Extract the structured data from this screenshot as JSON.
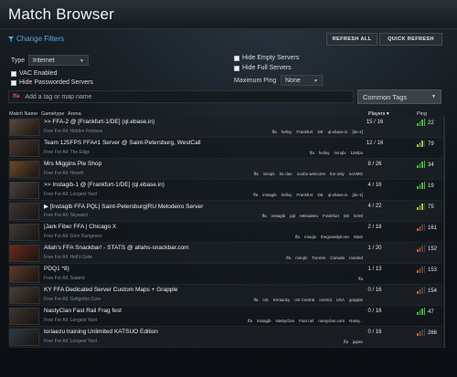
{
  "window": {
    "title": "Match Browser"
  },
  "filters": {
    "change_filters_label": "Change Filters",
    "refresh_all_label": "REFRESH ALL",
    "quick_refresh_label": "QUICK REFRESH",
    "type_label": "Type",
    "type_value": "Internet",
    "vac_enabled_label": "VAC Enabled",
    "hide_passworded_label": "Hide Passworded Servers",
    "hide_empty_label": "Hide Empty Servers",
    "hide_full_label": "Hide Full Servers",
    "max_ping_label": "Maximum Ping",
    "max_ping_value": "None",
    "tag_placeholder": "Add a tag or map name",
    "tag_icon_text": "ffa",
    "common_tags_label": "Common Tags"
  },
  "columns": {
    "match_name": "Match Name",
    "gametype": "Gametype",
    "arena": "Arena",
    "players": "Players",
    "ping": "Ping"
  },
  "colors": {
    "accent": "#5aa9e6",
    "ping_good": "#3fbf3f",
    "ping_mid": "#a8c83a",
    "ping_bad": "#e05a2a"
  },
  "servers": [
    {
      "name": ">> FFA-2 @ [Frankfurt-1/DE] (ql.ebase.in)",
      "mode": "Free For All: Hidden Fortress",
      "tags": [
        "ffa",
        "helloy",
        "Frankfurt",
        "DE",
        "ql.ebase.in",
        "[de-1]"
      ],
      "players": "15 / 16",
      "ping": "22",
      "quality": "good",
      "thumb": "#5a4a3a"
    },
    {
      "name": "Team 125FPS FFA#1 Server @ Saint-Petersburg, WestCall",
      "mode": "Free For All: The Edge",
      "tags": [
        "ffa",
        "helloy",
        "minqlx",
        "125fps"
      ],
      "players": "12 / 16",
      "ping": "79",
      "quality": "mid",
      "thumb": "#4a3a2e"
    },
    {
      "name": "Mrs Miggins Pie Shop",
      "mode": "Free For All: Hearth",
      "tags": [
        "ffa",
        "minqlx",
        "lts clan",
        "noobs welcome",
        "fun only",
        "noVMG"
      ],
      "players": "8 / 26",
      "ping": "34",
      "quality": "good",
      "thumb": "#6a4a2a"
    },
    {
      "name": ">> Instagib-1 @ [Frankfurt-1/DE] (ql.ebase.in)",
      "mode": "Free For All: Longest Yard",
      "tags": [
        "ffa",
        "instagib",
        "helloy",
        "Frankfurt",
        "DE",
        "ql.ebase.in",
        "[de-1]"
      ],
      "players": "4 / 16",
      "ping": "19",
      "quality": "good",
      "thumb": "#4a4440"
    },
    {
      "name": "▶ [Instagib FFA PQL] Saint-Petersburg|RU Melodeiro Server",
      "mode": "Free For All: Skyward",
      "tags": [
        "ffa",
        "instagib",
        "pql",
        "Melodeiro",
        "Frankfurt",
        "DE",
        "EAM"
      ],
      "players": "4 / 22",
      "ping": "75",
      "quality": "mid",
      "thumb": "#3a3634"
    },
    {
      "name": "|Jark Fiber FFA | Chicago X",
      "mode": "Free For All: Grim Dungeons",
      "tags": [
        "ffa",
        "minqlx",
        "thegravelpit.net",
        "Stats"
      ],
      "players": "2 / 18",
      "ping": "161",
      "quality": "bad",
      "thumb": "#3e3a36"
    },
    {
      "name": "Allah's FFA Snackbar! - STATS @ allahs-snackbar.com",
      "mode": "Free For All: Hell's Gate",
      "tags": [
        "ffa",
        "minqlx",
        "Toronto",
        "Canada",
        "roasted"
      ],
      "players": "1 / 20",
      "ping": "152",
      "quality": "bad",
      "thumb": "#6a2a1a"
    },
    {
      "name": "PDQ1 *8)",
      "mode": "Free For All: Satanic",
      "tags": [
        "ffa"
      ],
      "players": "1 / 13",
      "ping": "153",
      "quality": "bad",
      "thumb": "#5a3a2a"
    },
    {
      "name": "KY FFA Dedicated Server Custom Maps + Grapple",
      "mode": "Free For All: Gollgothe Core",
      "tags": [
        "ffa",
        "US",
        "Kentucky",
        "US Central",
        "central",
        "USA",
        "grapple"
      ],
      "players": "0 / 16",
      "ping": "154",
      "quality": "bad",
      "thumb": "#4a4038"
    },
    {
      "name": "NastyClan Fast Rail Frag fest",
      "mode": "Free For All: Longest Yard",
      "tags": [
        "ffa",
        "instagib",
        "NastyClan",
        "Fast rail",
        "nastyclan.com",
        "Nasty..."
      ],
      "players": "0 / 16",
      "ping": "47",
      "quality": "good",
      "thumb": "#3a342e"
    },
    {
      "name": "toriaezu training Unlimited KATSUO Edition",
      "mode": "Free For All: Longest Yard",
      "tags": [
        "ffa",
        "japan"
      ],
      "players": "0 / 16",
      "ping": "266",
      "quality": "bad",
      "thumb": "#2e3a42"
    }
  ]
}
